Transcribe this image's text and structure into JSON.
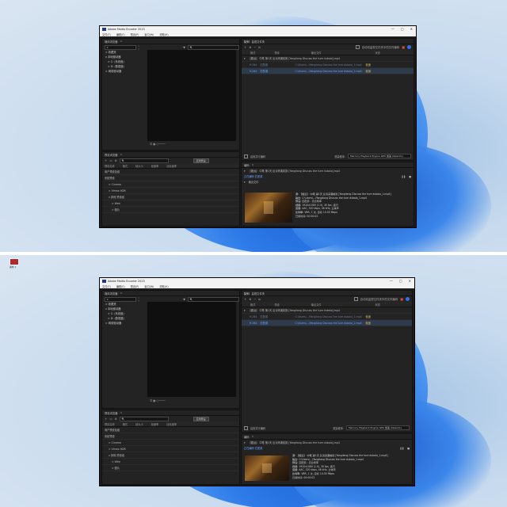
{
  "app": {
    "title": "Adobe Media Encoder 2023",
    "menus": [
      "文件(F)",
      "编辑(E)",
      "预设(P)",
      "窗口(W)",
      "帮助(H)"
    ],
    "window_controls": [
      "—",
      "▢",
      "✕"
    ]
  },
  "media_browser": {
    "title": "媒体浏览器",
    "filter_placeholder": "",
    "tree": [
      "> 收藏夹",
      "v 本地驱动器",
      ">  C: (系统盘)",
      ">  D: (数据盘)",
      "> 网络驱动器"
    ],
    "tree_bottom": [
      "> 收藏夹",
      "v 本地驱动器",
      ">  C: (系统盘)",
      ">  D: (数据盘)",
      "> 网络驱动器"
    ]
  },
  "preset_browser": {
    "title": "预设浏览器",
    "apply_button": "应用预设",
    "columns": [
      "预设名称",
      "格式",
      "帧大小",
      "帧速率",
      "目标速率"
    ],
    "items": [
      "用户预设及组",
      "系统预设",
      "> Cinema",
      "> Vimeo HDR",
      "v 其他 预设组",
      "> Web",
      "> 图片"
    ]
  },
  "queue": {
    "tabs": [
      "队列",
      "监视文件夹"
    ],
    "auto_encode": "自动将监视文件夹中的文件编码",
    "columns": [
      "格式",
      "预设",
      "输出文件",
      "状态"
    ],
    "items": [
      {
        "name": "【搬运】 中笔 第1天 反派来袭前篇 [Yangliang Discuss the ture dubaio].mp4",
        "format": "",
        "preset": "",
        "output": "",
        "status": ""
      },
      {
        "name": "H.264",
        "format": "H.264",
        "preset": "匹配源",
        "output": "C:\\Users\\...\\Yangliang Discuss the ture dubaio_1.mp4",
        "status": "就绪"
      },
      {
        "name": "H.264",
        "format": "H.264",
        "preset": "匹配源",
        "output": "C:\\Users\\...\\Yangliang Discuss the ture dubaio_2.mp4",
        "status": "就绪"
      }
    ],
    "renderer_label": "渲染程序:",
    "renderer_value": "Mercury Playback Engine GPU 加速 (OpenCL)",
    "parallel_label": "启用并行编码"
  },
  "encoding": {
    "title": "编码",
    "file": "【搬运】 中笔 第1天 反派来袭前篇 [Yangliang Discuss the ture dubaio].mp4",
    "status": "正在编码 匹配源",
    "output_label": "输出文件",
    "meta": [
      {
        "k": "源:",
        "v": "【搬运】 中笔 第1天 反派来袭前篇 [Yangliang Discuss the ture dubaio_1.mp4]"
      },
      {
        "k": "输出:",
        "v": "C:\\Users\\...\\Yangliang Discuss the ture dubaio_1.mp4"
      },
      {
        "k": "预设:",
        "v": "匹配源 - 高比特率"
      },
      {
        "k": "视频:",
        "v": "1920x1080 (1.0), 30 fps, 逐行"
      },
      {
        "k": "音频:",
        "v": "AAC, 320 kbps, 48 kHz, 立体声"
      },
      {
        "k": "比特率:",
        "v": "VBR, 1 次, 目标 10.00 Mbps"
      },
      {
        "k": "",
        "v": "已用时间: 00:00:02"
      }
    ]
  },
  "desktop": {
    "icon_label": "素材 1"
  }
}
